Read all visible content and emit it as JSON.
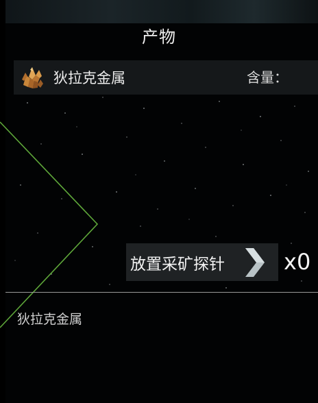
{
  "panel": {
    "title": "产物"
  },
  "product": {
    "name": "狄拉克金属",
    "content_label": "含量：",
    "icon": "ore-crystal-icon"
  },
  "probe": {
    "button_label": "放置采矿探针",
    "arrow_icon": "chevron-right-icon",
    "count": "x0"
  },
  "detail": {
    "name": "狄拉克金属"
  },
  "colors": {
    "accent_green": "#5fa83a",
    "background": "#020304",
    "row_bg": "#15181a",
    "button_bg": "#1f2224"
  }
}
